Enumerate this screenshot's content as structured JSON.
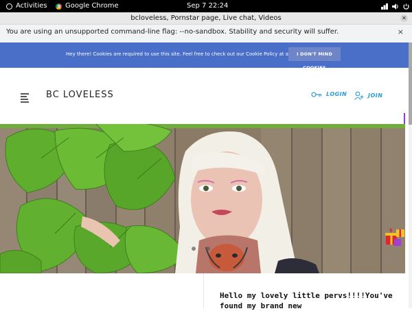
{
  "system_bar": {
    "activities": "Activities",
    "app": "Google Chrome",
    "datetime": "Sep 7  22:24"
  },
  "window": {
    "title": "bcloveless, Pornstar page, Live chat, Videos"
  },
  "infobar": {
    "message": "You are using an unsupported command-line flag: --no-sandbox. Stability and security will suffer.",
    "close": "×"
  },
  "cookie_banner": {
    "text": "Hey there! Cookies are required to use this site. Feel free to check out our Cookie Policy at any time.",
    "button": "I DON'T MIND COOKIES",
    "color": "#4a6fc9"
  },
  "header": {
    "logo": "BC LOVELESS",
    "login": "LOGIN",
    "join": "JOIN",
    "accent": "#2b9bd6"
  },
  "content": {
    "intro": "Hello my lovely little pervs!!!!You've found my brand new"
  },
  "icons": {
    "menu": "hamburger-menu-icon",
    "login": "key-icon",
    "join": "add-user-icon",
    "gift": "gift-icon"
  }
}
